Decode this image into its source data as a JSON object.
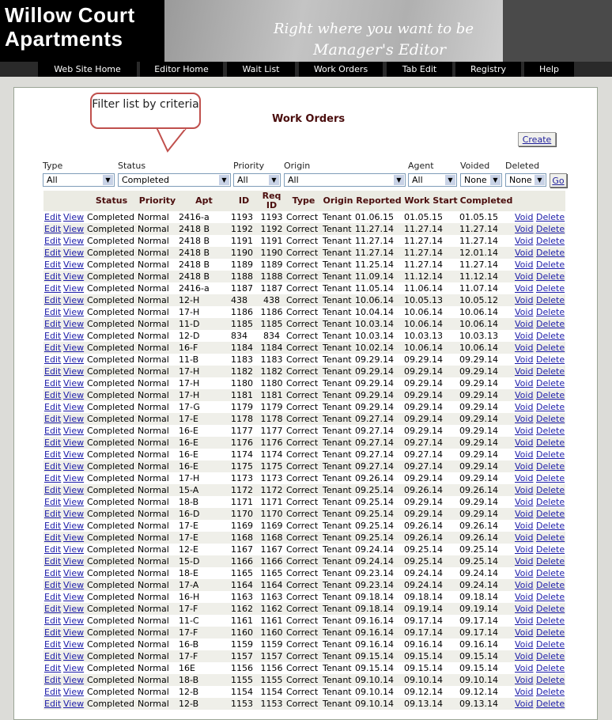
{
  "header": {
    "logo_line1": "Willow Court",
    "logo_line2": "Apartments",
    "tagline": "Right where you want to be",
    "subtitle": "Manager's Editor"
  },
  "nav": [
    "Web Site Home",
    "Editor Home",
    "Wait List",
    "Work Orders",
    "Tab Edit",
    "Registry",
    "Help"
  ],
  "callout": "Filter list by criteria",
  "page_title": "Work Orders",
  "create_label": "Create",
  "go_label": "Go",
  "filters": {
    "type": {
      "label": "Type",
      "value": "All"
    },
    "status": {
      "label": "Status",
      "value": "Completed"
    },
    "priority": {
      "label": "Priority",
      "value": "All"
    },
    "origin": {
      "label": "Origin",
      "value": "All"
    },
    "agent": {
      "label": "Agent",
      "value": "All"
    },
    "voided": {
      "label": "Voided",
      "value": "None"
    },
    "deleted": {
      "label": "Deleted",
      "value": "None"
    }
  },
  "columns": [
    "",
    "",
    "Status",
    "Priority",
    "Apt",
    "ID",
    "Req ID",
    "Type",
    "Origin",
    "Reported",
    "Work Start",
    "Completed",
    "",
    ""
  ],
  "actions": {
    "edit": "Edit",
    "view": "View",
    "void": "Void",
    "delete": "Delete"
  },
  "colors": {
    "accent_red": "#c0504d",
    "header_text": "#4a0d0d",
    "link": "#1b1ba8"
  },
  "rows": [
    [
      "Completed",
      "Normal",
      "2416-a",
      "1193",
      "1193",
      "Correct",
      "Tenant",
      "01.06.15",
      "01.05.15",
      "01.05.15"
    ],
    [
      "Completed",
      "Normal",
      "2418 B",
      "1192",
      "1192",
      "Correct",
      "Tenant",
      "11.27.14",
      "11.27.14",
      "11.27.14"
    ],
    [
      "Completed",
      "Normal",
      "2418 B",
      "1191",
      "1191",
      "Correct",
      "Tenant",
      "11.27.14",
      "11.27.14",
      "11.27.14"
    ],
    [
      "Completed",
      "Normal",
      "2418 B",
      "1190",
      "1190",
      "Correct",
      "Tenant",
      "11.27.14",
      "11.27.14",
      "12.01.14"
    ],
    [
      "Completed",
      "Normal",
      "2418 B",
      "1189",
      "1189",
      "Correct",
      "Tenant",
      "11.25.14",
      "11.27.14",
      "11.27.14"
    ],
    [
      "Completed",
      "Normal",
      "2418 B",
      "1188",
      "1188",
      "Correct",
      "Tenant",
      "11.09.14",
      "11.12.14",
      "11.12.14"
    ],
    [
      "Completed",
      "Normal",
      "2416-a",
      "1187",
      "1187",
      "Correct",
      "Tenant",
      "11.05.14",
      "11.06.14",
      "11.07.14"
    ],
    [
      "Completed",
      "Normal",
      "12-H",
      "438",
      "438",
      "Correct",
      "Tenant",
      "10.06.14",
      "10.05.13",
      "10.05.12"
    ],
    [
      "Completed",
      "Normal",
      "17-H",
      "1186",
      "1186",
      "Correct",
      "Tenant",
      "10.04.14",
      "10.06.14",
      "10.06.14"
    ],
    [
      "Completed",
      "Normal",
      "11-D",
      "1185",
      "1185",
      "Correct",
      "Tenant",
      "10.03.14",
      "10.06.14",
      "10.06.14"
    ],
    [
      "Completed",
      "Normal",
      "12-D",
      "834",
      "834",
      "Correct",
      "Tenant",
      "10.03.14",
      "10.03.13",
      "10.03.13"
    ],
    [
      "Completed",
      "Normal",
      "16-F",
      "1184",
      "1184",
      "Correct",
      "Tenant",
      "10.02.14",
      "10.06.14",
      "10.06.14"
    ],
    [
      "Completed",
      "Normal",
      "11-B",
      "1183",
      "1183",
      "Correct",
      "Tenant",
      "09.29.14",
      "09.29.14",
      "09.29.14"
    ],
    [
      "Completed",
      "Normal",
      "17-H",
      "1182",
      "1182",
      "Correct",
      "Tenant",
      "09.29.14",
      "09.29.14",
      "09.29.14"
    ],
    [
      "Completed",
      "Normal",
      "17-H",
      "1180",
      "1180",
      "Correct",
      "Tenant",
      "09.29.14",
      "09.29.14",
      "09.29.14"
    ],
    [
      "Completed",
      "Normal",
      "17-H",
      "1181",
      "1181",
      "Correct",
      "Tenant",
      "09.29.14",
      "09.29.14",
      "09.29.14"
    ],
    [
      "Completed",
      "Normal",
      "17-G",
      "1179",
      "1179",
      "Correct",
      "Tenant",
      "09.29.14",
      "09.29.14",
      "09.29.14"
    ],
    [
      "Completed",
      "Normal",
      "17-E",
      "1178",
      "1178",
      "Correct",
      "Tenant",
      "09.27.14",
      "09.29.14",
      "09.29.14"
    ],
    [
      "Completed",
      "Normal",
      "16-E",
      "1177",
      "1177",
      "Correct",
      "Tenant",
      "09.27.14",
      "09.29.14",
      "09.29.14"
    ],
    [
      "Completed",
      "Normal",
      "16-E",
      "1176",
      "1176",
      "Correct",
      "Tenant",
      "09.27.14",
      "09.27.14",
      "09.29.14"
    ],
    [
      "Completed",
      "Normal",
      "16-E",
      "1174",
      "1174",
      "Correct",
      "Tenant",
      "09.27.14",
      "09.27.14",
      "09.29.14"
    ],
    [
      "Completed",
      "Normal",
      "16-E",
      "1175",
      "1175",
      "Correct",
      "Tenant",
      "09.27.14",
      "09.27.14",
      "09.29.14"
    ],
    [
      "Completed",
      "Normal",
      "17-H",
      "1173",
      "1173",
      "Correct",
      "Tenant",
      "09.26.14",
      "09.29.14",
      "09.29.14"
    ],
    [
      "Completed",
      "Normal",
      "15-A",
      "1172",
      "1172",
      "Correct",
      "Tenant",
      "09.25.14",
      "09.26.14",
      "09.26.14"
    ],
    [
      "Completed",
      "Normal",
      "18-B",
      "1171",
      "1171",
      "Correct",
      "Tenant",
      "09.25.14",
      "09.29.14",
      "09.29.14"
    ],
    [
      "Completed",
      "Normal",
      "16-D",
      "1170",
      "1170",
      "Correct",
      "Tenant",
      "09.25.14",
      "09.29.14",
      "09.29.14"
    ],
    [
      "Completed",
      "Normal",
      "17-E",
      "1169",
      "1169",
      "Correct",
      "Tenant",
      "09.25.14",
      "09.26.14",
      "09.26.14"
    ],
    [
      "Completed",
      "Normal",
      "17-E",
      "1168",
      "1168",
      "Correct",
      "Tenant",
      "09.25.14",
      "09.26.14",
      "09.26.14"
    ],
    [
      "Completed",
      "Normal",
      "12-E",
      "1167",
      "1167",
      "Correct",
      "Tenant",
      "09.24.14",
      "09.25.14",
      "09.25.14"
    ],
    [
      "Completed",
      "Normal",
      "15-D",
      "1166",
      "1166",
      "Correct",
      "Tenant",
      "09.24.14",
      "09.25.14",
      "09.25.14"
    ],
    [
      "Completed",
      "Normal",
      "18-E",
      "1165",
      "1165",
      "Correct",
      "Tenant",
      "09.23.14",
      "09.24.14",
      "09.24.14"
    ],
    [
      "Completed",
      "Normal",
      "17-A",
      "1164",
      "1164",
      "Correct",
      "Tenant",
      "09.23.14",
      "09.24.14",
      "09.24.14"
    ],
    [
      "Completed",
      "Normal",
      "16-H",
      "1163",
      "1163",
      "Correct",
      "Tenant",
      "09.18.14",
      "09.18.14",
      "09.18.14"
    ],
    [
      "Completed",
      "Normal",
      "17-F",
      "1162",
      "1162",
      "Correct",
      "Tenant",
      "09.18.14",
      "09.19.14",
      "09.19.14"
    ],
    [
      "Completed",
      "Normal",
      "11-C",
      "1161",
      "1161",
      "Correct",
      "Tenant",
      "09.16.14",
      "09.17.14",
      "09.17.14"
    ],
    [
      "Completed",
      "Normal",
      "17-F",
      "1160",
      "1160",
      "Correct",
      "Tenant",
      "09.16.14",
      "09.17.14",
      "09.17.14"
    ],
    [
      "Completed",
      "Normal",
      "16-B",
      "1159",
      "1159",
      "Correct",
      "Tenant",
      "09.16.14",
      "09.16.14",
      "09.16.14"
    ],
    [
      "Completed",
      "Normal",
      "17-F",
      "1157",
      "1157",
      "Correct",
      "Tenant",
      "09.15.14",
      "09.15.14",
      "09.15.14"
    ],
    [
      "Completed",
      "Normal",
      "16E",
      "1156",
      "1156",
      "Correct",
      "Tenant",
      "09.15.14",
      "09.15.14",
      "09.15.14"
    ],
    [
      "Completed",
      "Normal",
      "18-B",
      "1155",
      "1155",
      "Correct",
      "Tenant",
      "09.10.14",
      "09.10.14",
      "09.10.14"
    ],
    [
      "Completed",
      "Normal",
      "12-B",
      "1154",
      "1154",
      "Correct",
      "Tenant",
      "09.10.14",
      "09.12.14",
      "09.12.14"
    ],
    [
      "Completed",
      "Normal",
      "12-B",
      "1153",
      "1153",
      "Correct",
      "Tenant",
      "09.10.14",
      "09.13.14",
      "09.13.14"
    ]
  ]
}
